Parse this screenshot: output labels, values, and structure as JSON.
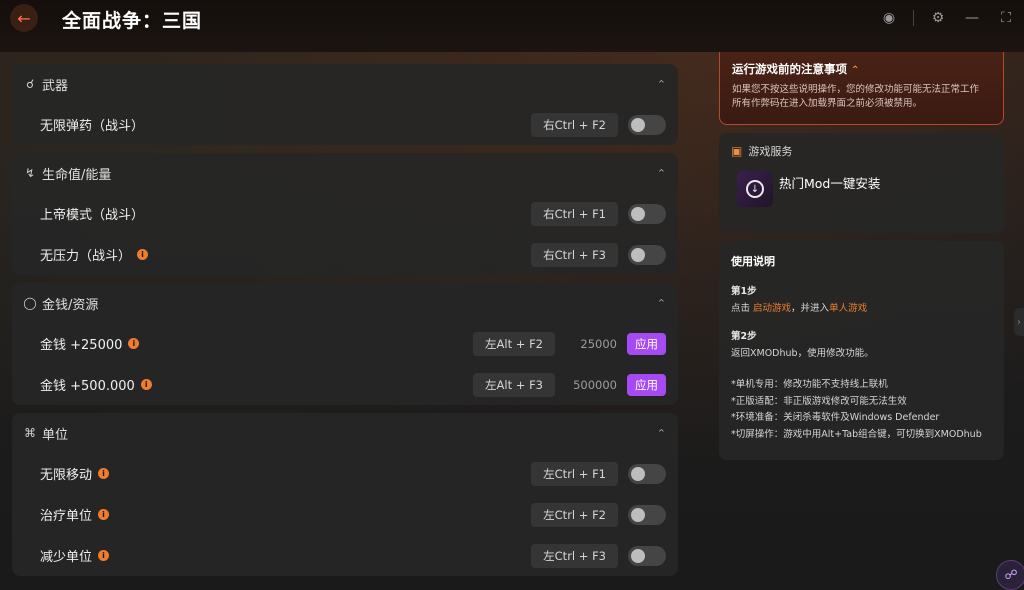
{
  "header": {
    "title": "全面战争：三国",
    "back_icon": "arrow-left-icon"
  },
  "sections": [
    {
      "name": "weapons",
      "title": "武器",
      "icon": "gun-icon",
      "rows": [
        {
          "label": "无限弹药（战斗）",
          "info": false,
          "hotkey": "右Ctrl + F2",
          "type": "toggle"
        }
      ]
    },
    {
      "name": "health",
      "title": "生命值/能量",
      "icon": "bolt-icon",
      "rows": [
        {
          "label": "上帝模式（战斗）",
          "info": false,
          "hotkey": "右Ctrl + F1",
          "type": "toggle"
        },
        {
          "label": "无压力（战斗）",
          "info": true,
          "hotkey": "右Ctrl + F3",
          "type": "toggle"
        }
      ]
    },
    {
      "name": "money",
      "title": "金钱/资源",
      "icon": "money-bag-icon",
      "rows": [
        {
          "label": "金钱 +25000",
          "info": true,
          "hotkey": "左Alt + F2",
          "type": "apply",
          "value": "25000",
          "apply": "应用"
        },
        {
          "label": "金钱 +500.000",
          "info": true,
          "hotkey": "左Alt + F3",
          "type": "apply",
          "value": "500000",
          "apply": "应用"
        }
      ]
    },
    {
      "name": "units",
      "title": "单位",
      "icon": "units-icon",
      "rows": [
        {
          "label": "无限移动",
          "info": true,
          "hotkey": "左Ctrl + F1",
          "type": "toggle"
        },
        {
          "label": "治疗单位",
          "info": true,
          "hotkey": "左Ctrl + F2",
          "type": "toggle"
        },
        {
          "label": "减少单位",
          "info": true,
          "hotkey": "左Ctrl + F3",
          "type": "toggle"
        }
      ]
    }
  ],
  "notice": {
    "title": "运行游戏前的注意事项",
    "line1": "如果您不按这些说明操作，您的修改功能可能无法正常工作",
    "line2": "所有作弊码在进入加载界面之前必须被禁用。"
  },
  "service": {
    "title": "游戏服务",
    "item": "热门Mod一键安装"
  },
  "guide": {
    "title": "使用说明",
    "step1_title": "第1步",
    "step1_a": "点击 ",
    "step1_b": "启动游戏",
    "step1_c": "，并进入",
    "step1_d": "单人游戏",
    "step2_title": "第2步",
    "step2": "返回XMODhub，使用修改功能。",
    "notes": [
      "*单机专用：修改功能不支持线上联机",
      "*正版适配：非正版游戏修改可能无法生效",
      "*环境准备：关闭杀毒软件及Windows Defender",
      "*切屏操作：游戏中用Alt+Tab组合键，可切换到XMODhub"
    ]
  },
  "colors": {
    "accent_orange": "#ef7d2d",
    "apply_purple": "#a64bf4"
  }
}
